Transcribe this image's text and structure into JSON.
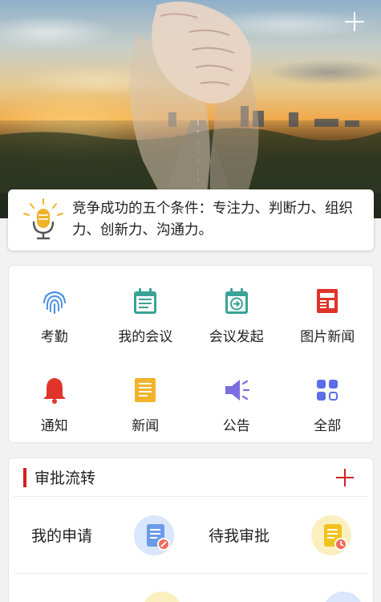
{
  "notice": {
    "text": "竞争成功的五个条件：专注力、判断力、组织力、创新力、沟通力。"
  },
  "grid": [
    {
      "label": "考勤",
      "icon": "fingerprint-icon",
      "color": "#4a90e2"
    },
    {
      "label": "我的会议",
      "icon": "calendar-list-icon",
      "color": "#3aa395"
    },
    {
      "label": "会议发起",
      "icon": "calendar-arrow-icon",
      "color": "#3aa395"
    },
    {
      "label": "图片新闻",
      "icon": "newspaper-icon",
      "color": "#e0332a"
    },
    {
      "label": "通知",
      "icon": "bell-icon",
      "color": "#e0332a"
    },
    {
      "label": "新闻",
      "icon": "document-icon",
      "color": "#f0b32a"
    },
    {
      "label": "公告",
      "icon": "megaphone-icon",
      "color": "#7b6fe0"
    },
    {
      "label": "全部",
      "icon": "grid-apps-icon",
      "color": "#5b6ee8"
    }
  ],
  "approval": {
    "title": "审批流转",
    "items": [
      {
        "label": "我的申请",
        "icon": "my-application-icon",
        "color": "#6a9be8"
      },
      {
        "label": "待我审批",
        "icon": "pending-approval-icon",
        "color": "#f2c21e"
      }
    ]
  },
  "colors": {
    "accent": "#d51f1f",
    "background": "#f2f2f2"
  }
}
